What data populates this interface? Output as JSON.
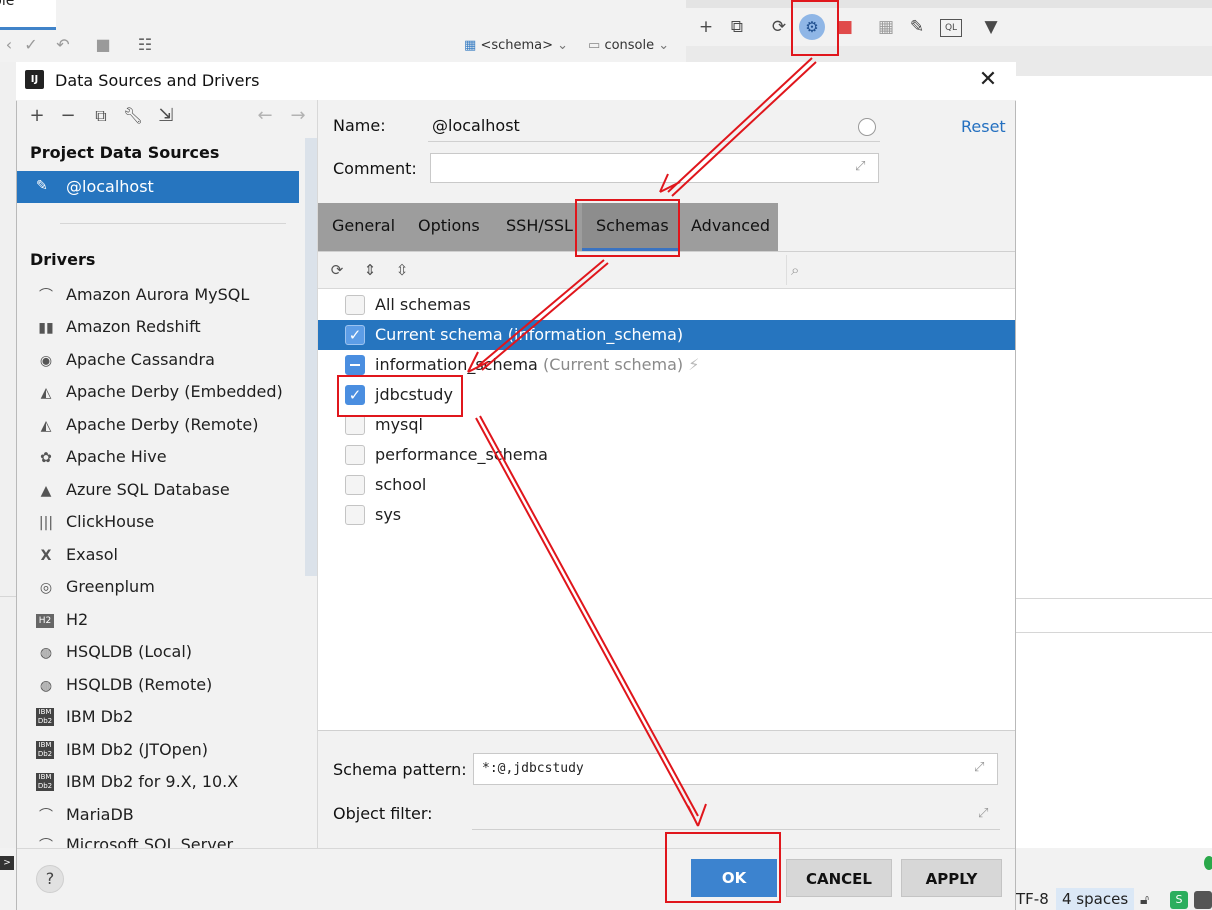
{
  "ide": {
    "tab_label": "sole",
    "schema_combo": "<schema>",
    "console_combo": "console",
    "status": {
      "encoding": "TF-8",
      "indent": "4 spaces"
    }
  },
  "dialog": {
    "title": "Data Sources and Drivers",
    "left": {
      "project_heading": "Project Data Sources",
      "selected_source": "@localhost",
      "drivers_heading": "Drivers",
      "drivers": [
        {
          "label": "Amazon Aurora MySQL",
          "icon": "dolphin-icon"
        },
        {
          "label": "Amazon Redshift",
          "icon": "redshift-icon"
        },
        {
          "label": "Apache Cassandra",
          "icon": "eye-icon"
        },
        {
          "label": "Apache Derby (Embedded)",
          "icon": "hat-icon"
        },
        {
          "label": "Apache Derby (Remote)",
          "icon": "hat-icon"
        },
        {
          "label": "Apache Hive",
          "icon": "bee-icon"
        },
        {
          "label": "Azure SQL Database",
          "icon": "azure-icon"
        },
        {
          "label": "ClickHouse",
          "icon": "bars-icon"
        },
        {
          "label": "Exasol",
          "icon": "x-icon"
        },
        {
          "label": "Greenplum",
          "icon": "greenplum-icon"
        },
        {
          "label": "H2",
          "icon": "h2-icon"
        },
        {
          "label": "HSQLDB (Local)",
          "icon": "hsqldb-icon"
        },
        {
          "label": "HSQLDB (Remote)",
          "icon": "hsqldb-icon"
        },
        {
          "label": "IBM Db2",
          "icon": "ibm-db2-icon"
        },
        {
          "label": "IBM Db2 (JTOpen)",
          "icon": "ibm-db2-icon"
        },
        {
          "label": "IBM Db2 for 9.X, 10.X",
          "icon": "ibm-db2-icon"
        },
        {
          "label": "MariaDB",
          "icon": "mariadb-icon"
        },
        {
          "label": "Microsoft SQL Server",
          "icon": "sqlserver-icon"
        }
      ]
    },
    "right": {
      "name_label": "Name:",
      "name_value": "@localhost",
      "reset_label": "Reset",
      "comment_label": "Comment:",
      "comment_value": "",
      "tabs": [
        "General",
        "Options",
        "SSH/SSL",
        "Schemas",
        "Advanced"
      ],
      "active_tab": "Schemas",
      "schemas": [
        {
          "label": "All schemas",
          "sub": "",
          "state": "unchecked"
        },
        {
          "label": "Current schema (information_schema)",
          "sub": "",
          "state": "checked-selected"
        },
        {
          "label": "information_schema",
          "sub": "(Current schema)",
          "state": "partial"
        },
        {
          "label": "jdbcstudy",
          "sub": "",
          "state": "checked"
        },
        {
          "label": "mysql",
          "sub": "",
          "state": "unchecked"
        },
        {
          "label": "performance_schema",
          "sub": "",
          "state": "unchecked"
        },
        {
          "label": "school",
          "sub": "",
          "state": "unchecked"
        },
        {
          "label": "sys",
          "sub": "",
          "state": "unchecked"
        }
      ],
      "schema_pattern_label": "Schema pattern:",
      "schema_pattern_value": "*:@,jdbcstudy",
      "object_filter_label": "Object filter:",
      "object_filter_value": ""
    },
    "footer": {
      "help": "?",
      "ok": "OK",
      "cancel": "CANCEL",
      "apply": "APPLY"
    }
  },
  "colors": {
    "selection": "#2675bf",
    "accent_link": "#2470c0",
    "annotation_red": "#e0161c",
    "ok_button": "#3c83cf"
  }
}
